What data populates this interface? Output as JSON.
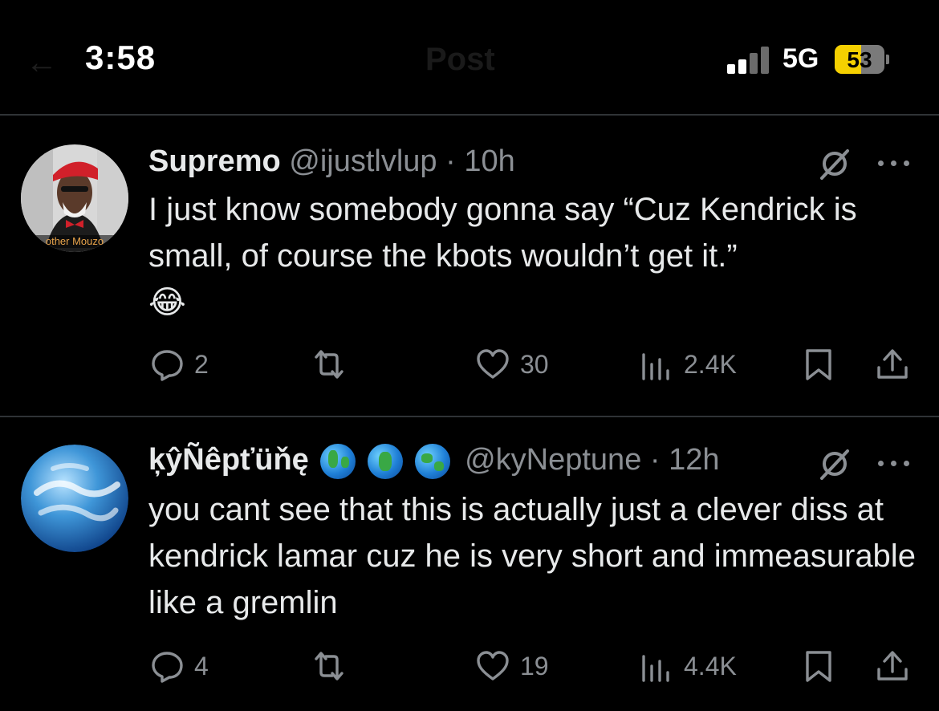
{
  "status_bar": {
    "time": "3:58",
    "network": "5G",
    "battery": "53",
    "battery_level": 0.53
  },
  "header": {
    "title": "Post"
  },
  "posts": [
    {
      "display_name": "Supremo",
      "handle": "@ijustlvlup",
      "separator": "·",
      "age": "10h",
      "avatar_caption": "other Mouzo",
      "text": "I just know somebody gonna say “Cuz Kendrick is small, of course the kbots wouldn’t get it.”",
      "emoji": "😂",
      "replies": "2",
      "reposts": "",
      "likes": "30",
      "views": "2.4K"
    },
    {
      "display_name": "ķŷÑêpťüňę",
      "handle": "@kyNeptune",
      "separator": "·",
      "age": "12h",
      "text": "you cant see that this is actually just a clever diss at kendrick lamar cuz he is very short and immeasurable like a gremlin",
      "replies": "4",
      "reposts": "",
      "likes": "19",
      "views": "4.4K"
    }
  ],
  "icons": [
    "back-arrow-icon",
    "signal-icon",
    "battery-icon",
    "grok-icon",
    "more-icon",
    "reply-icon",
    "repost-icon",
    "like-icon",
    "views-icon",
    "bookmark-icon",
    "share-icon",
    "globe-icon"
  ],
  "colors": {
    "background": "#000000",
    "text": "#e7e9ea",
    "secondary": "#8b8f94",
    "divider": "#2f3336",
    "battery": "#f5d000"
  }
}
